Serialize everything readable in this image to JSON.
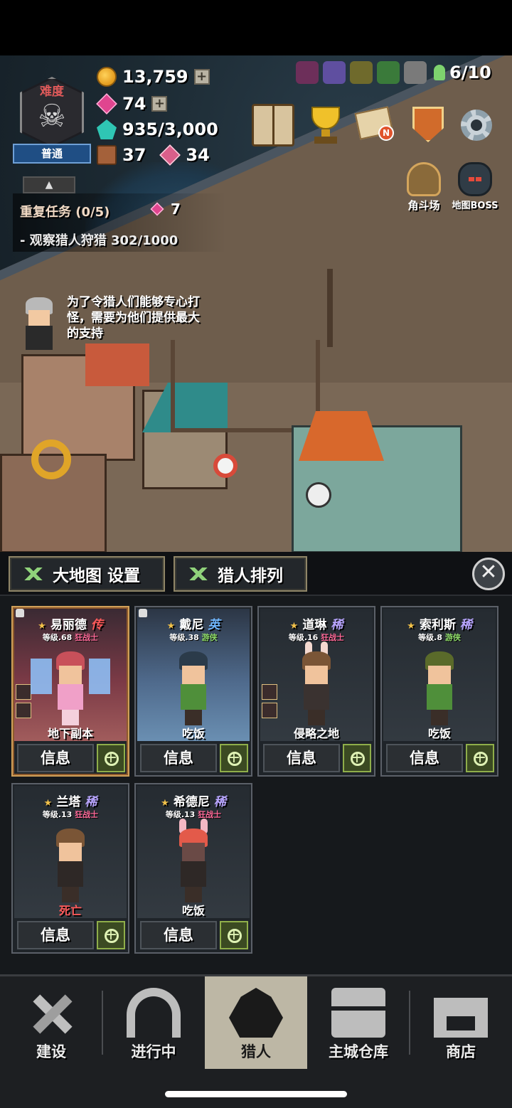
{
  "difficulty": {
    "label": "难度",
    "level": "普通"
  },
  "resources": {
    "gold": "13,759",
    "gems": "74",
    "essence": "935/3,000",
    "chests": "37",
    "crystals": "34"
  },
  "hunters_count": "6/10",
  "quest": {
    "title": "重复任务 (0/5)",
    "reward": "7",
    "objective": "-  观察猎人狩猎 302/1000"
  },
  "npc_message": "为了令猎人们能够专心打怪，需要为他们提供最大的支持",
  "top_menu": {
    "mail_badge": "N",
    "arena_label": "角斗场",
    "map_boss_label": "地图BOSS"
  },
  "panel": {
    "tab_map_settings": "大地图 设置",
    "tab_hunter_order": "猎人排列",
    "close_symbol": "✕",
    "info_label": "信息"
  },
  "hunters": [
    {
      "name": "易丽德",
      "rank": "传",
      "level": "等级.68",
      "class": "狂战士",
      "status": "地下副本"
    },
    {
      "name": "戴尼",
      "rank": "英",
      "level": "等级.38",
      "class": "游侠",
      "status": "吃饭"
    },
    {
      "name": "道琳",
      "rank": "稀",
      "level": "等级.16",
      "class": "狂战士",
      "status": "侵略之地"
    },
    {
      "name": "索利斯",
      "rank": "稀",
      "level": "等级.8",
      "class": "游侠",
      "status": "吃饭"
    },
    {
      "name": "兰塔",
      "rank": "稀",
      "level": "等级.13",
      "class": "狂战士",
      "status": "死亡"
    },
    {
      "name": "希德尼",
      "rank": "稀",
      "level": "等级.13",
      "class": "狂战士",
      "status": "吃饭"
    }
  ],
  "nav": {
    "build": "建设",
    "in_progress": "进行中",
    "hunters": "猎人",
    "warehouse": "主城仓库",
    "shop": "商店"
  },
  "colors": {
    "accent_gold": "#f3c24a",
    "rank_legend": "#ff5a5a",
    "rank_hero": "#6fb6ff",
    "rank_rare": "#b8a5ff",
    "active_nav_bg": "#bdb7a5"
  }
}
